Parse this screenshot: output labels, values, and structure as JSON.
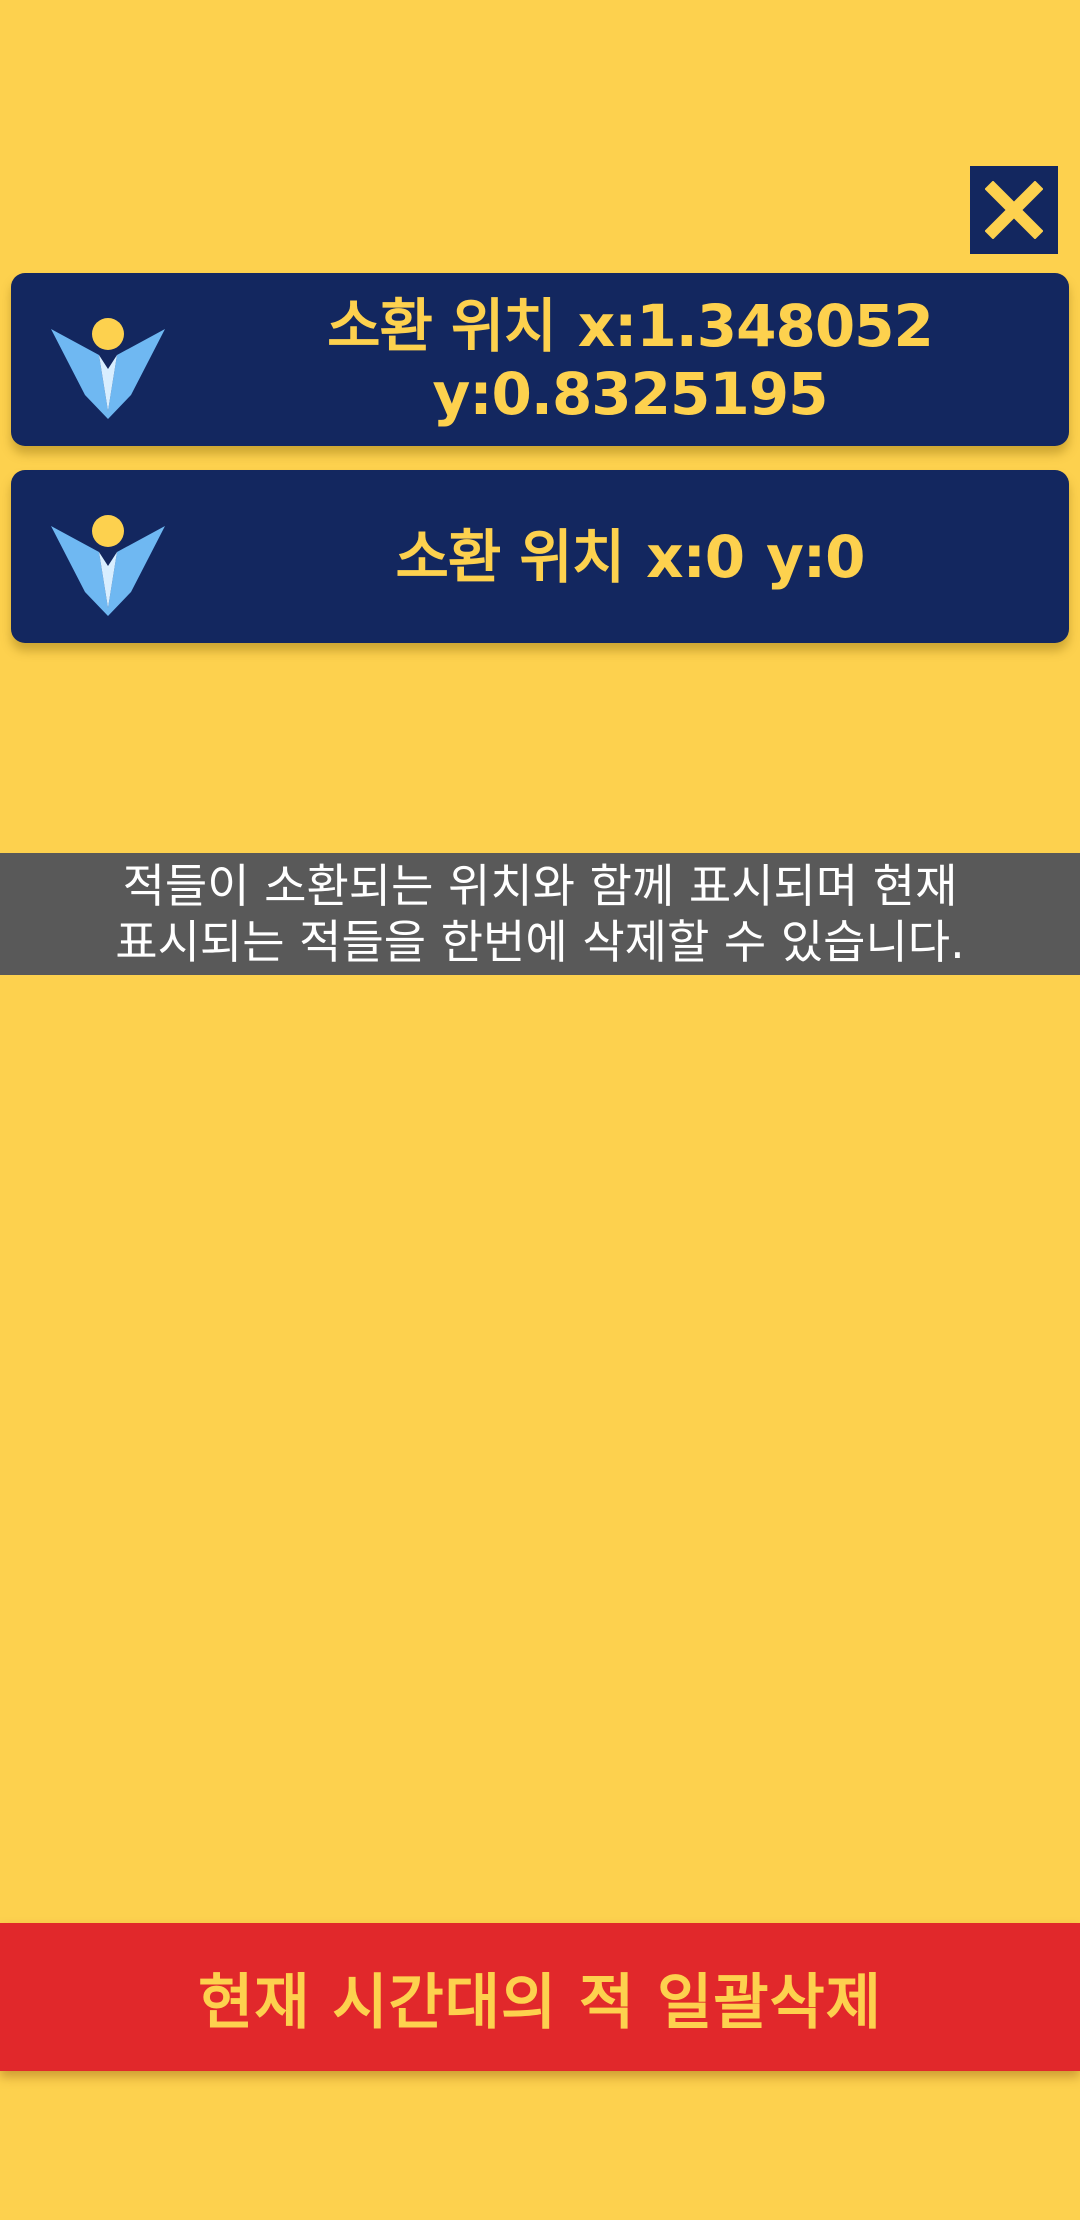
{
  "colors": {
    "background": "#FDD14E",
    "card": "#13275F",
    "accent_text": "#FDD14E",
    "tooltip_bg": "#595959",
    "delete_button": "#E1282B"
  },
  "close_button": {
    "icon": "close-icon"
  },
  "enemy_list": [
    {
      "icon": "enemy-marker-icon",
      "label": "소환 위치",
      "x_text": "x:1.348052",
      "y_text": "y:0.8325195"
    },
    {
      "icon": "enemy-marker-icon",
      "label": "소환 위치",
      "x_text": "x:0",
      "y_text": "y:0"
    }
  ],
  "tooltip": {
    "line1": "적들이 소환되는 위치와 함께 표시되며 현재",
    "line2": "표시되는 적들을 한번에 삭제할 수 있습니다."
  },
  "delete_all_button": {
    "label": "현재 시간대의 적 일괄삭제"
  }
}
